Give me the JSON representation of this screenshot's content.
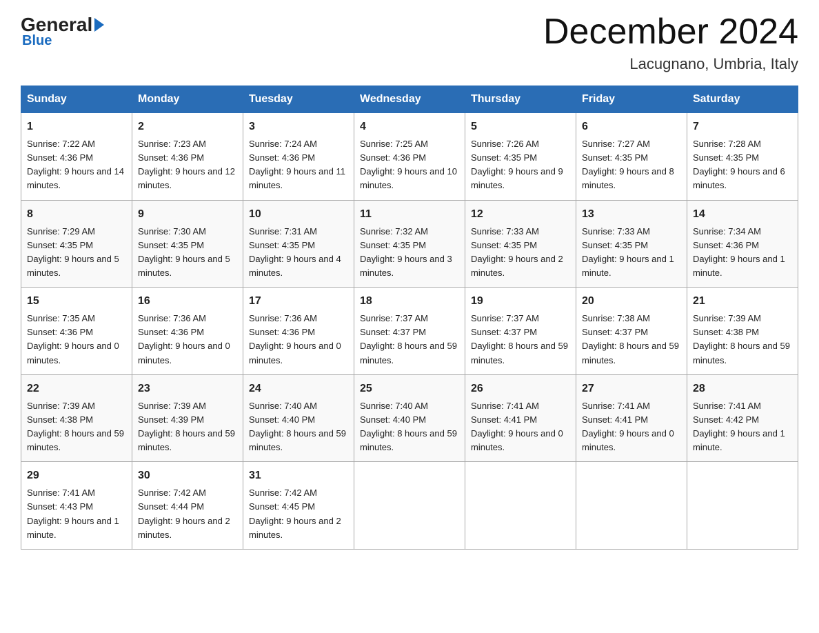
{
  "header": {
    "logo_general": "General",
    "logo_blue": "Blue",
    "month_title": "December 2024",
    "location": "Lacugnano, Umbria, Italy"
  },
  "days_of_week": [
    "Sunday",
    "Monday",
    "Tuesday",
    "Wednesday",
    "Thursday",
    "Friday",
    "Saturday"
  ],
  "weeks": [
    [
      {
        "day": "1",
        "sunrise": "7:22 AM",
        "sunset": "4:36 PM",
        "daylight": "9 hours and 14 minutes."
      },
      {
        "day": "2",
        "sunrise": "7:23 AM",
        "sunset": "4:36 PM",
        "daylight": "9 hours and 12 minutes."
      },
      {
        "day": "3",
        "sunrise": "7:24 AM",
        "sunset": "4:36 PM",
        "daylight": "9 hours and 11 minutes."
      },
      {
        "day": "4",
        "sunrise": "7:25 AM",
        "sunset": "4:36 PM",
        "daylight": "9 hours and 10 minutes."
      },
      {
        "day": "5",
        "sunrise": "7:26 AM",
        "sunset": "4:35 PM",
        "daylight": "9 hours and 9 minutes."
      },
      {
        "day": "6",
        "sunrise": "7:27 AM",
        "sunset": "4:35 PM",
        "daylight": "9 hours and 8 minutes."
      },
      {
        "day": "7",
        "sunrise": "7:28 AM",
        "sunset": "4:35 PM",
        "daylight": "9 hours and 6 minutes."
      }
    ],
    [
      {
        "day": "8",
        "sunrise": "7:29 AM",
        "sunset": "4:35 PM",
        "daylight": "9 hours and 5 minutes."
      },
      {
        "day": "9",
        "sunrise": "7:30 AM",
        "sunset": "4:35 PM",
        "daylight": "9 hours and 5 minutes."
      },
      {
        "day": "10",
        "sunrise": "7:31 AM",
        "sunset": "4:35 PM",
        "daylight": "9 hours and 4 minutes."
      },
      {
        "day": "11",
        "sunrise": "7:32 AM",
        "sunset": "4:35 PM",
        "daylight": "9 hours and 3 minutes."
      },
      {
        "day": "12",
        "sunrise": "7:33 AM",
        "sunset": "4:35 PM",
        "daylight": "9 hours and 2 minutes."
      },
      {
        "day": "13",
        "sunrise": "7:33 AM",
        "sunset": "4:35 PM",
        "daylight": "9 hours and 1 minute."
      },
      {
        "day": "14",
        "sunrise": "7:34 AM",
        "sunset": "4:36 PM",
        "daylight": "9 hours and 1 minute."
      }
    ],
    [
      {
        "day": "15",
        "sunrise": "7:35 AM",
        "sunset": "4:36 PM",
        "daylight": "9 hours and 0 minutes."
      },
      {
        "day": "16",
        "sunrise": "7:36 AM",
        "sunset": "4:36 PM",
        "daylight": "9 hours and 0 minutes."
      },
      {
        "day": "17",
        "sunrise": "7:36 AM",
        "sunset": "4:36 PM",
        "daylight": "9 hours and 0 minutes."
      },
      {
        "day": "18",
        "sunrise": "7:37 AM",
        "sunset": "4:37 PM",
        "daylight": "8 hours and 59 minutes."
      },
      {
        "day": "19",
        "sunrise": "7:37 AM",
        "sunset": "4:37 PM",
        "daylight": "8 hours and 59 minutes."
      },
      {
        "day": "20",
        "sunrise": "7:38 AM",
        "sunset": "4:37 PM",
        "daylight": "8 hours and 59 minutes."
      },
      {
        "day": "21",
        "sunrise": "7:39 AM",
        "sunset": "4:38 PM",
        "daylight": "8 hours and 59 minutes."
      }
    ],
    [
      {
        "day": "22",
        "sunrise": "7:39 AM",
        "sunset": "4:38 PM",
        "daylight": "8 hours and 59 minutes."
      },
      {
        "day": "23",
        "sunrise": "7:39 AM",
        "sunset": "4:39 PM",
        "daylight": "8 hours and 59 minutes."
      },
      {
        "day": "24",
        "sunrise": "7:40 AM",
        "sunset": "4:40 PM",
        "daylight": "8 hours and 59 minutes."
      },
      {
        "day": "25",
        "sunrise": "7:40 AM",
        "sunset": "4:40 PM",
        "daylight": "8 hours and 59 minutes."
      },
      {
        "day": "26",
        "sunrise": "7:41 AM",
        "sunset": "4:41 PM",
        "daylight": "9 hours and 0 minutes."
      },
      {
        "day": "27",
        "sunrise": "7:41 AM",
        "sunset": "4:41 PM",
        "daylight": "9 hours and 0 minutes."
      },
      {
        "day": "28",
        "sunrise": "7:41 AM",
        "sunset": "4:42 PM",
        "daylight": "9 hours and 1 minute."
      }
    ],
    [
      {
        "day": "29",
        "sunrise": "7:41 AM",
        "sunset": "4:43 PM",
        "daylight": "9 hours and 1 minute."
      },
      {
        "day": "30",
        "sunrise": "7:42 AM",
        "sunset": "4:44 PM",
        "daylight": "9 hours and 2 minutes."
      },
      {
        "day": "31",
        "sunrise": "7:42 AM",
        "sunset": "4:45 PM",
        "daylight": "9 hours and 2 minutes."
      },
      null,
      null,
      null,
      null
    ]
  ],
  "labels": {
    "sunrise": "Sunrise:",
    "sunset": "Sunset:",
    "daylight": "Daylight:"
  }
}
